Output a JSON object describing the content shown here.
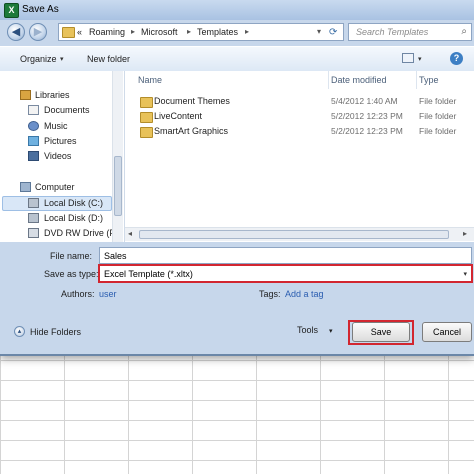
{
  "window": {
    "title": "Save As"
  },
  "address_bar": {
    "prefix": "«",
    "crumbs": [
      "Roaming",
      "Microsoft",
      "Templates"
    ],
    "search_placeholder": "Search Templates"
  },
  "toolbar": {
    "organize_label": "Organize",
    "new_folder_label": "New folder"
  },
  "nav_pane": {
    "items": [
      {
        "label": "Libraries",
        "icon": "library-icon"
      },
      {
        "label": "Documents",
        "icon": "documents-icon"
      },
      {
        "label": "Music",
        "icon": "music-icon"
      },
      {
        "label": "Pictures",
        "icon": "pictures-icon"
      },
      {
        "label": "Videos",
        "icon": "videos-icon"
      },
      {
        "label": "Computer",
        "icon": "computer-icon"
      },
      {
        "label": "Local Disk (C:)",
        "icon": "drive-icon"
      },
      {
        "label": "Local Disk (D:)",
        "icon": "drive-icon"
      },
      {
        "label": "DVD RW Drive (F:",
        "icon": "dvd-icon"
      }
    ],
    "selected": "Local Disk (C:)"
  },
  "file_list": {
    "columns": [
      "Name",
      "Date modified",
      "Type"
    ],
    "rows": [
      {
        "name": "Document Themes",
        "date": "5/4/2012 1:40 AM",
        "type": "File folder"
      },
      {
        "name": "LiveContent",
        "date": "5/2/2012 12:23 PM",
        "type": "File folder"
      },
      {
        "name": "SmartArt Graphics",
        "date": "5/2/2012 12:23 PM",
        "type": "File folder"
      }
    ]
  },
  "form": {
    "file_name_label": "File name:",
    "file_name_value": "Sales",
    "save_as_type_label": "Save as type:",
    "save_as_type_value": "Excel Template (*.xltx)",
    "authors_label": "Authors:",
    "authors_value": "user",
    "tags_label": "Tags:",
    "tags_value": "Add a tag"
  },
  "footer": {
    "hide_folders_label": "Hide Folders",
    "tools_label": "Tools",
    "save_label": "Save",
    "cancel_label": "Cancel"
  },
  "colors": {
    "highlight": "#d22630",
    "dialog_bg": "#c7d7eb",
    "link": "#2a5db0"
  }
}
